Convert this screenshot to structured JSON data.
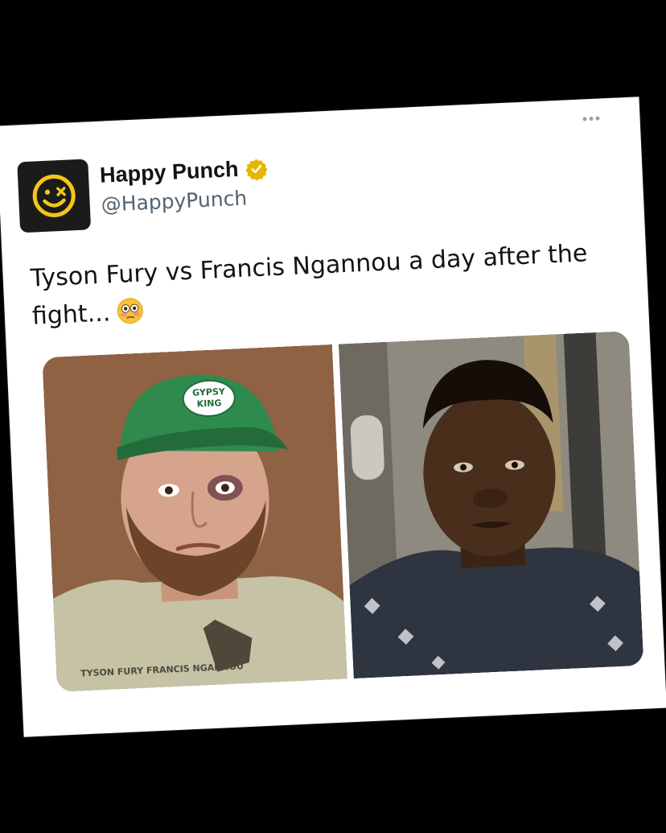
{
  "post": {
    "author": {
      "display_name": "Happy Punch",
      "handle": "@HappyPunch",
      "verified": true,
      "verified_badge_color": "#e8b500"
    },
    "more_menu_icon": "more-horizontal-icon",
    "text": "Tyson Fury vs Francis Ngannou a day after the fight...",
    "emoji": "flushed-face-emoji",
    "media": {
      "images": [
        {
          "subject": "tyson-fury-photo",
          "cap_text": "GYPSY KING",
          "shirt_text": "TYSON FURY FRANCIS NGANNOU"
        },
        {
          "subject": "francis-ngannou-photo"
        }
      ]
    }
  },
  "colors": {
    "background": "#000000",
    "card": "#ffffff",
    "text": "#0f1419",
    "secondary_text": "#536471",
    "avatar_bg": "#1b1b1b",
    "avatar_accent": "#f5c518"
  }
}
